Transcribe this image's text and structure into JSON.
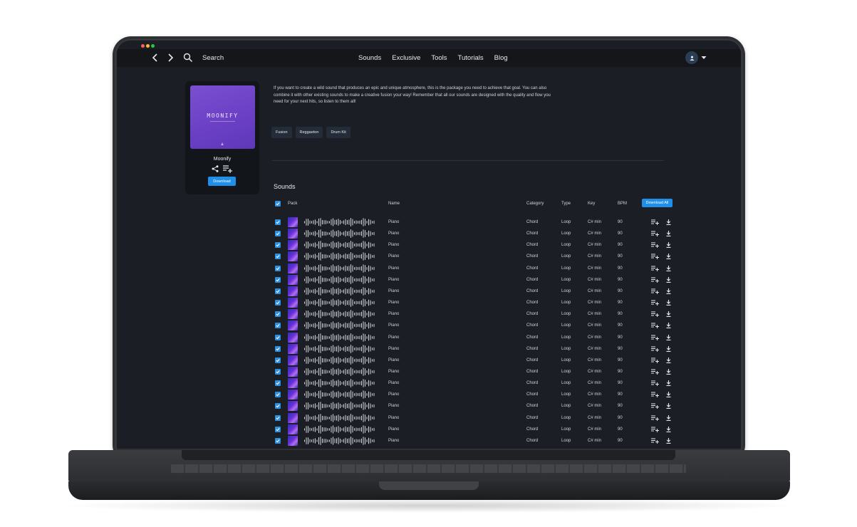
{
  "colors": {
    "accent": "#1f8fe8",
    "background": "#1b1f25",
    "topbar": "#141619",
    "cover": "#6a3fc4",
    "traffic_red": "#ff5f57",
    "traffic_yellow": "#febc2e",
    "traffic_green": "#28c840"
  },
  "header": {
    "search_label": "Search",
    "nav": [
      "Sounds",
      "Exclusive",
      "Tools",
      "Tutorials",
      "Blog"
    ]
  },
  "pack": {
    "cover_title": "MOONIFY",
    "name": "Moonify",
    "download_label": "Download",
    "description": "If you want to create a wild sound that produces an epic and unique atmosphere, this is the package you need to achieve that goal. You can also combine it with other existing sounds to make a creative fusion your way! Remember that all our sounds are designed with the quality and flow you need for your next hits, so listen to them all!",
    "tags": [
      "Fusion",
      "Reggaeton",
      "Drum Kit"
    ]
  },
  "sounds": {
    "title": "Sounds",
    "columns": {
      "pack": "Pack",
      "name": "Name",
      "category": "Category",
      "type": "Type",
      "key": "Key",
      "bpm": "BPM"
    },
    "download_all_label": "Download All",
    "rows": [
      {
        "name": "Piano",
        "category": "Chord",
        "type": "Loop",
        "key": "C# min",
        "bpm": "90",
        "checked": true
      },
      {
        "name": "Piano",
        "category": "Chord",
        "type": "Loop",
        "key": "C# min",
        "bpm": "90",
        "checked": true
      },
      {
        "name": "Piano",
        "category": "Chord",
        "type": "Loop",
        "key": "C# min",
        "bpm": "90",
        "checked": true
      },
      {
        "name": "Piano",
        "category": "Chord",
        "type": "Loop",
        "key": "C# min",
        "bpm": "90",
        "checked": true
      },
      {
        "name": "Piano",
        "category": "Chord",
        "type": "Loop",
        "key": "C# min",
        "bpm": "90",
        "checked": true
      },
      {
        "name": "Piano",
        "category": "Chord",
        "type": "Loop",
        "key": "C# min",
        "bpm": "90",
        "checked": true
      },
      {
        "name": "Piano",
        "category": "Chord",
        "type": "Loop",
        "key": "C# min",
        "bpm": "90",
        "checked": true
      },
      {
        "name": "Piano",
        "category": "Chord",
        "type": "Loop",
        "key": "C# min",
        "bpm": "90",
        "checked": true
      },
      {
        "name": "Piano",
        "category": "Chord",
        "type": "Loop",
        "key": "C# min",
        "bpm": "90",
        "checked": true
      },
      {
        "name": "Piano",
        "category": "Chord",
        "type": "Loop",
        "key": "C# min",
        "bpm": "90",
        "checked": true
      },
      {
        "name": "Piano",
        "category": "Chord",
        "type": "Loop",
        "key": "C# min",
        "bpm": "90",
        "checked": true
      },
      {
        "name": "Piano",
        "category": "Chord",
        "type": "Loop",
        "key": "C# min",
        "bpm": "90",
        "checked": true
      },
      {
        "name": "Piano",
        "category": "Chord",
        "type": "Loop",
        "key": "C# min",
        "bpm": "90",
        "checked": true
      },
      {
        "name": "Piano",
        "category": "Chord",
        "type": "Loop",
        "key": "C# min",
        "bpm": "90",
        "checked": true
      },
      {
        "name": "Piano",
        "category": "Chord",
        "type": "Loop",
        "key": "C# min",
        "bpm": "90",
        "checked": true
      },
      {
        "name": "Piano",
        "category": "Chord",
        "type": "Loop",
        "key": "C# min",
        "bpm": "90",
        "checked": true
      },
      {
        "name": "Piano",
        "category": "Chord",
        "type": "Loop",
        "key": "C# min",
        "bpm": "90",
        "checked": true
      },
      {
        "name": "Piano",
        "category": "Chord",
        "type": "Loop",
        "key": "C# min",
        "bpm": "90",
        "checked": true
      },
      {
        "name": "Piano",
        "category": "Chord",
        "type": "Loop",
        "key": "C# min",
        "bpm": "90",
        "checked": true
      },
      {
        "name": "Piano",
        "category": "Chord",
        "type": "Loop",
        "key": "C# min",
        "bpm": "90",
        "checked": true
      }
    ]
  }
}
